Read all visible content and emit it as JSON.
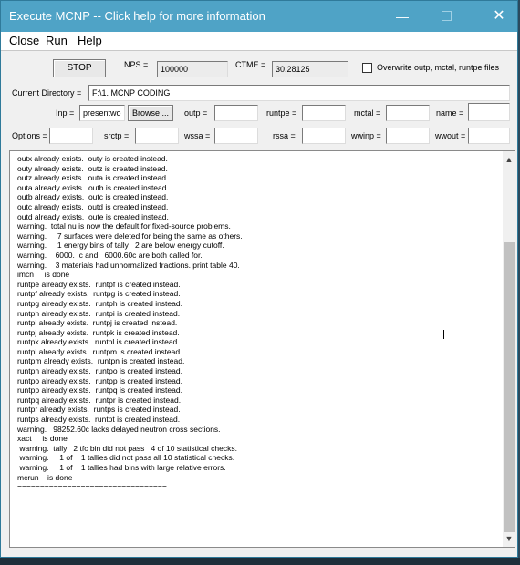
{
  "window": {
    "title": "Execute MCNP -- Click help for more information",
    "minimize_glyph": "—",
    "close_glyph": "✕"
  },
  "menu": {
    "close": "Close",
    "run": "Run",
    "help": "Help"
  },
  "controls": {
    "stop_label": "STOP",
    "nps_label": "NPS =",
    "nps_value": "100000",
    "ctme_label": "CTME =",
    "ctme_value": "30.28125",
    "overwrite_label": "Overwrite outp, mctal, runtpe files",
    "overwrite_checked": false,
    "current_dir_label": "Current Directory =",
    "current_dir_value": "F:\\1. MCNP CODING",
    "inp_label": "Inp =",
    "inp_value": "presentwo",
    "browse_label": "Browse ...",
    "outp_label": "outp =",
    "runtpe_label": "runtpe =",
    "mctal_label": "mctal =",
    "name_label": "name =",
    "options_label": "Options =",
    "srctp_label": "srctp =",
    "wssa_label": "wssa =",
    "rssa_label": "rssa =",
    "wwinp_label": "wwinp =",
    "wwout_label": "wwout ="
  },
  "output": {
    "lines": [
      "outx already exists.  outy is created instead.",
      "outy already exists.  outz is created instead.",
      "outz already exists.  outa is created instead.",
      "outa already exists.  outb is created instead.",
      "outb already exists.  outc is created instead.",
      "outc already exists.  outd is created instead.",
      "outd already exists.  oute is created instead.",
      "warning.  total nu is now the default for fixed-source problems.",
      "warning.     7 surfaces were deleted for being the same as others.",
      "warning.     1 energy bins of tally   2 are below energy cutoff.",
      "warning.    6000.  c and   6000.60c are both called for.",
      "warning.    3 materials had unnormalized fractions. print table 40.",
      "imcn     is done",
      "runtpe already exists.  runtpf is created instead.",
      "runtpf already exists.  runtpg is created instead.",
      "runtpg already exists.  runtph is created instead.",
      "runtph already exists.  runtpi is created instead.",
      "runtpi already exists.  runtpj is created instead.",
      "runtpj already exists.  runtpk is created instead.",
      "runtpk already exists.  runtpl is created instead.",
      "runtpl already exists.  runtpm is created instead.",
      "runtpm already exists.  runtpn is created instead.",
      "runtpn already exists.  runtpo is created instead.",
      "runtpo already exists.  runtpp is created instead.",
      "runtpp already exists.  runtpq is created instead.",
      "runtpq already exists.  runtpr is created instead.",
      "runtpr already exists.  runtps is created instead.",
      "runtps already exists.  runtpt is created instead.",
      "warning.   98252.60c lacks delayed neutron cross sections.",
      "xact     is done",
      " warning.  tally   2 tfc bin did not pass   4 of 10 statistical checks.",
      " warning.     1 of    1 tallies did not pass all 10 statistical checks.",
      " warning.     1 of    1 tallies had bins with large relative errors.",
      "mcrun    is done",
      "================================="
    ]
  }
}
